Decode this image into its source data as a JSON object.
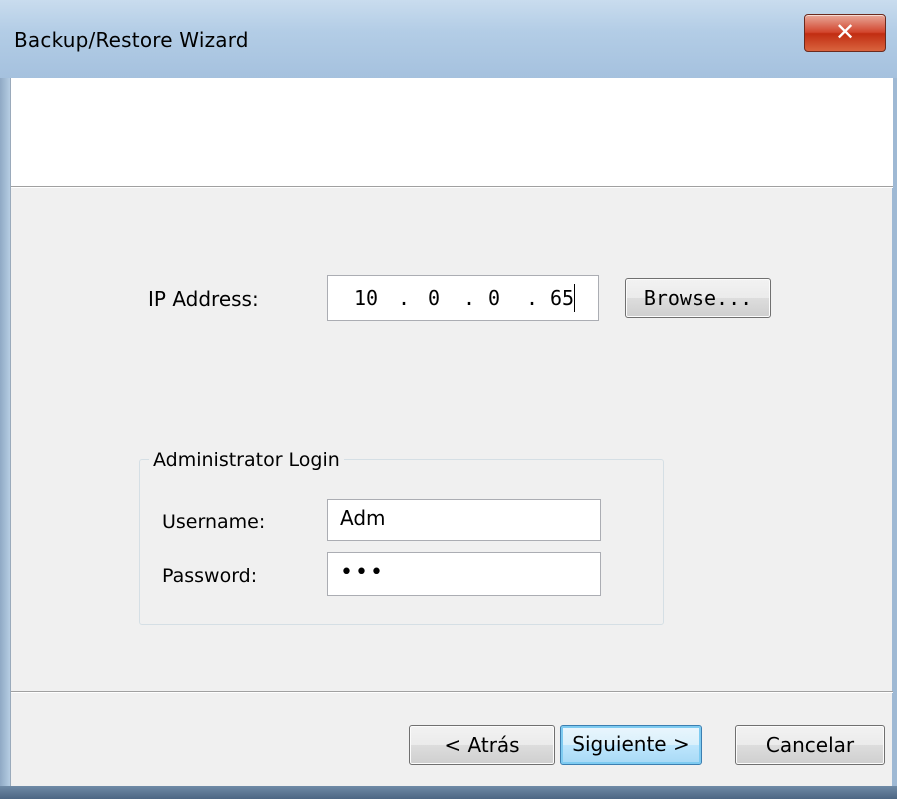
{
  "window": {
    "title": "Backup/Restore Wizard",
    "close_glyph": "✕"
  },
  "ip": {
    "label": "IP Address:",
    "octets": [
      "10",
      "0",
      "0",
      "65"
    ],
    "separator": "."
  },
  "browse": {
    "label": "Browse..."
  },
  "admin_login": {
    "group_label": "Administrator Login",
    "username_label": "Username:",
    "username_value": "Adm",
    "password_label": "Password:",
    "password_value": "•••"
  },
  "footer": {
    "back_label": "< Atrás",
    "next_label": "Siguiente >",
    "cancel_label": "Cancelar"
  },
  "colors": {
    "title_bar": "#b3cde6",
    "close_button": "#c12d12",
    "client_bg": "#f0f0f0",
    "default_button_border": "#3c7fb1"
  }
}
